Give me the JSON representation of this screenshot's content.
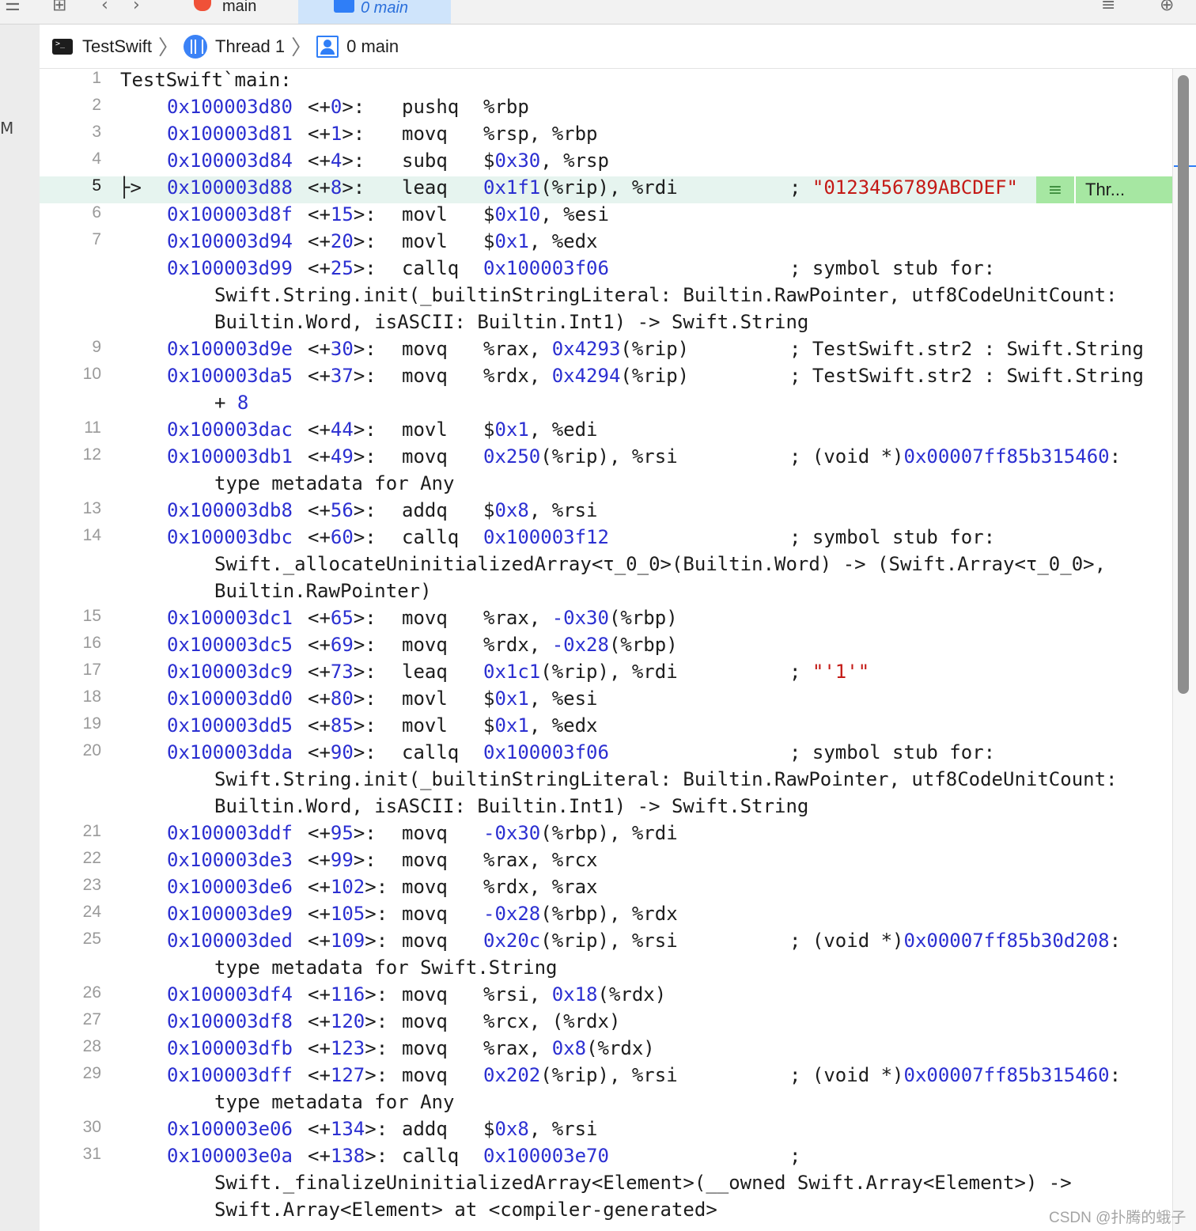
{
  "tabs": {
    "main_label": "main",
    "active_label": "0 main"
  },
  "jumpbar": {
    "project": "TestSwift",
    "thread": "Thread 1",
    "frame": "0 main"
  },
  "left_strip_glyph": "M",
  "icons": {
    "nav_back": "chevron-left-icon",
    "nav_forward": "chevron-right-icon",
    "grid": "related-items-icon",
    "list": "editor-options-icon",
    "add": "add-editor-icon"
  },
  "badge": {
    "thread_label": "Thr..."
  },
  "watermark": "CSDN @扑腾的蛾子",
  "lines": [
    {
      "n": "1",
      "title": "TestSwift`main:"
    },
    {
      "n": "2",
      "addr": "0x100003d80",
      "off": "0",
      "mn": "pushq",
      "ops": "%rbp"
    },
    {
      "n": "3",
      "addr": "0x100003d81",
      "off": "1",
      "mn": "movq",
      "ops": "%rsp, %rbp"
    },
    {
      "n": "4",
      "addr": "0x100003d84",
      "off": "4",
      "mn": "subq",
      "ops": "$0x30, %rsp"
    },
    {
      "n": "5",
      "addr": "0x100003d88",
      "off": "8",
      "mn": "leaq",
      "ops": "0x1f1(%rip), %rdi",
      "cmt": "; ",
      "str": "\"0123456789ABCDEF\"",
      "current": true
    },
    {
      "n": "6",
      "addr": "0x100003d8f",
      "off": "15",
      "mn": "movl",
      "ops": "$0x10, %esi"
    },
    {
      "n": "7",
      "addr": "0x100003d94",
      "off": "20",
      "mn": "movl",
      "ops": "$0x1, %edx"
    },
    {
      "n": "",
      "addr": "0x100003d99",
      "off": "25",
      "mn": "callq",
      "ops": "0x100003f06",
      "cmt": "; symbol stub for:"
    },
    {
      "cont": "Swift.String.init(_builtinStringLiteral: Builtin.RawPointer, utf8CodeUnitCount:"
    },
    {
      "cont": "Builtin.Word, isASCII: Builtin.Int1) -> Swift.String"
    },
    {
      "n": "9",
      "addr": "0x100003d9e",
      "off": "30",
      "mn": "movq",
      "ops": "%rax, 0x4293(%rip)",
      "cmt": "; TestSwift.str2 : Swift.String"
    },
    {
      "n": "10",
      "addr": "0x100003da5",
      "off": "37",
      "mn": "movq",
      "ops": "%rdx, 0x4294(%rip)",
      "cmt": "; TestSwift.str2 : Swift.String"
    },
    {
      "cont": "+ 8"
    },
    {
      "n": "11",
      "addr": "0x100003dac",
      "off": "44",
      "mn": "movl",
      "ops": "$0x1, %edi"
    },
    {
      "n": "12",
      "addr": "0x100003db1",
      "off": "49",
      "mn": "movq",
      "ops": "0x250(%rip), %rsi",
      "cmt": "; (void *)0x00007ff85b315460:"
    },
    {
      "cont": "type metadata for Any"
    },
    {
      "n": "13",
      "addr": "0x100003db8",
      "off": "56",
      "mn": "addq",
      "ops": "$0x8, %rsi"
    },
    {
      "n": "14",
      "addr": "0x100003dbc",
      "off": "60",
      "mn": "callq",
      "ops": "0x100003f12",
      "cmt": "; symbol stub for:"
    },
    {
      "cont": "Swift._allocateUninitializedArray<τ_0_0>(Builtin.Word) -> (Swift.Array<τ_0_0>,"
    },
    {
      "cont": "Builtin.RawPointer)"
    },
    {
      "n": "15",
      "addr": "0x100003dc1",
      "off": "65",
      "mn": "movq",
      "ops": "%rax, -0x30(%rbp)"
    },
    {
      "n": "16",
      "addr": "0x100003dc5",
      "off": "69",
      "mn": "movq",
      "ops": "%rdx, -0x28(%rbp)"
    },
    {
      "n": "17",
      "addr": "0x100003dc9",
      "off": "73",
      "mn": "leaq",
      "ops": "0x1c1(%rip), %rdi",
      "cmt": "; ",
      "str": "\"'1'\""
    },
    {
      "n": "18",
      "addr": "0x100003dd0",
      "off": "80",
      "mn": "movl",
      "ops": "$0x1, %esi"
    },
    {
      "n": "19",
      "addr": "0x100003dd5",
      "off": "85",
      "mn": "movl",
      "ops": "$0x1, %edx"
    },
    {
      "n": "20",
      "addr": "0x100003dda",
      "off": "90",
      "mn": "callq",
      "ops": "0x100003f06",
      "cmt": "; symbol stub for:"
    },
    {
      "cont": "Swift.String.init(_builtinStringLiteral: Builtin.RawPointer, utf8CodeUnitCount:"
    },
    {
      "cont": "Builtin.Word, isASCII: Builtin.Int1) -> Swift.String"
    },
    {
      "n": "21",
      "addr": "0x100003ddf",
      "off": "95",
      "mn": "movq",
      "ops": "-0x30(%rbp), %rdi"
    },
    {
      "n": "22",
      "addr": "0x100003de3",
      "off": "99",
      "mn": "movq",
      "ops": "%rax, %rcx"
    },
    {
      "n": "23",
      "addr": "0x100003de6",
      "off": "102",
      "mn": "movq",
      "ops": "%rdx, %rax"
    },
    {
      "n": "24",
      "addr": "0x100003de9",
      "off": "105",
      "mn": "movq",
      "ops": "-0x28(%rbp), %rdx"
    },
    {
      "n": "25",
      "addr": "0x100003ded",
      "off": "109",
      "mn": "movq",
      "ops": "0x20c(%rip), %rsi",
      "cmt": "; (void *)0x00007ff85b30d208:"
    },
    {
      "cont": "type metadata for Swift.String"
    },
    {
      "n": "26",
      "addr": "0x100003df4",
      "off": "116",
      "mn": "movq",
      "ops": "%rsi, 0x18(%rdx)"
    },
    {
      "n": "27",
      "addr": "0x100003df8",
      "off": "120",
      "mn": "movq",
      "ops": "%rcx, (%rdx)"
    },
    {
      "n": "28",
      "addr": "0x100003dfb",
      "off": "123",
      "mn": "movq",
      "ops": "%rax, 0x8(%rdx)"
    },
    {
      "n": "29",
      "addr": "0x100003dff",
      "off": "127",
      "mn": "movq",
      "ops": "0x202(%rip), %rsi",
      "cmt": "; (void *)0x00007ff85b315460:"
    },
    {
      "cont": "type metadata for Any"
    },
    {
      "n": "30",
      "addr": "0x100003e06",
      "off": "134",
      "mn": "addq",
      "ops": "$0x8, %rsi"
    },
    {
      "n": "31",
      "addr": "0x100003e0a",
      "off": "138",
      "mn": "callq",
      "ops": "0x100003e70",
      "cmt": ";"
    },
    {
      "cont": "Swift._finalizeUninitializedArray<Element>(__owned Swift.Array<Element>) ->"
    },
    {
      "cont": "Swift.Array<Element> at <compiler-generated>"
    }
  ]
}
